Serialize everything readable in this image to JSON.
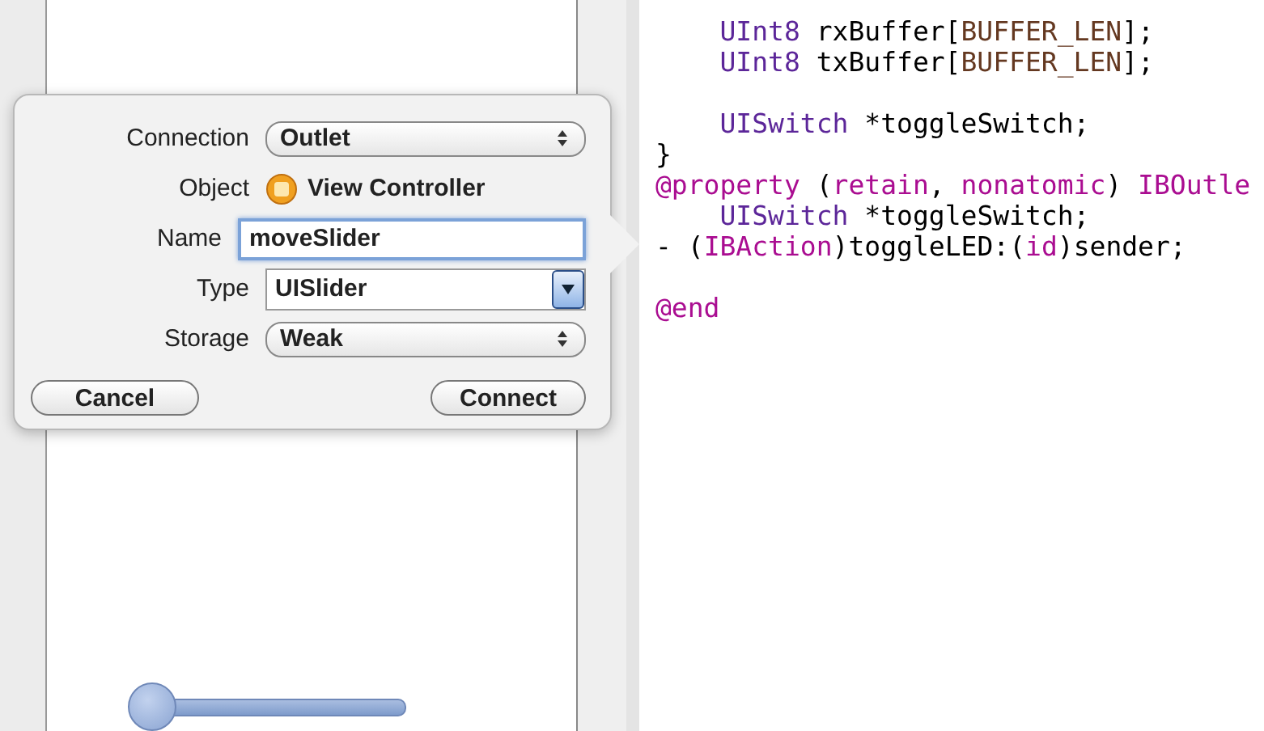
{
  "popover": {
    "rows": [
      {
        "kind": "popup",
        "label": "Connection",
        "value": "Outlet"
      },
      {
        "kind": "object",
        "label": "Object",
        "value": "View Controller"
      },
      {
        "kind": "text",
        "label": "Name",
        "value": "moveSlider",
        "focused": true
      },
      {
        "kind": "combo",
        "label": "Type",
        "value": "UISlider"
      },
      {
        "kind": "popup",
        "label": "Storage",
        "value": "Weak"
      }
    ],
    "buttons": [
      {
        "label": "Cancel"
      },
      {
        "label": "Connect"
      }
    ]
  },
  "canvas": {
    "slider": {
      "level": 0
    }
  },
  "code": [
    {
      "kind": "code",
      "indented": true,
      "tokens": [
        {
          "text": "UInt8",
          "kind": "type"
        },
        {
          "text": " rxBuffer[",
          "kind": "plain"
        },
        {
          "text": "BUFFER_LEN",
          "kind": "macro"
        },
        {
          "text": "];",
          "kind": "plain"
        }
      ]
    },
    {
      "kind": "code",
      "indented": true,
      "tokens": [
        {
          "text": "UInt8",
          "kind": "type"
        },
        {
          "text": " txBuffer[",
          "kind": "plain"
        },
        {
          "text": "BUFFER_LEN",
          "kind": "macro"
        },
        {
          "text": "];",
          "kind": "plain"
        }
      ]
    },
    {
      "kind": "blank"
    },
    {
      "kind": "code",
      "indented": true,
      "tokens": [
        {
          "text": "UISwitch",
          "kind": "type"
        },
        {
          "text": " *toggleSwitch;",
          "kind": "plain"
        }
      ]
    },
    {
      "kind": "code",
      "indented": false,
      "tokens": [
        {
          "text": "}",
          "kind": "plain"
        }
      ]
    },
    {
      "kind": "code",
      "indented": false,
      "tokens": [
        {
          "text": "@property",
          "kind": "keyword"
        },
        {
          "text": " (",
          "kind": "plain"
        },
        {
          "text": "retain",
          "kind": "keyword"
        },
        {
          "text": ", ",
          "kind": "plain"
        },
        {
          "text": "nonatomic",
          "kind": "keyword"
        },
        {
          "text": ") ",
          "kind": "plain"
        },
        {
          "text": "IBOutle",
          "kind": "keyword"
        }
      ]
    },
    {
      "kind": "code",
      "indented": true,
      "tokens": [
        {
          "text": "UISwitch",
          "kind": "type"
        },
        {
          "text": " *toggleSwitch;",
          "kind": "plain"
        }
      ]
    },
    {
      "kind": "code",
      "indented": false,
      "tokens": [
        {
          "text": "- (",
          "kind": "plain"
        },
        {
          "text": "IBAction",
          "kind": "keyword"
        },
        {
          "text": ")toggleLED:(",
          "kind": "plain"
        },
        {
          "text": "id",
          "kind": "keyword"
        },
        {
          "text": ")sender;",
          "kind": "plain"
        }
      ]
    },
    {
      "kind": "blank"
    },
    {
      "kind": "code",
      "indented": false,
      "tokens": [
        {
          "text": "@end",
          "kind": "keyword"
        }
      ]
    }
  ]
}
